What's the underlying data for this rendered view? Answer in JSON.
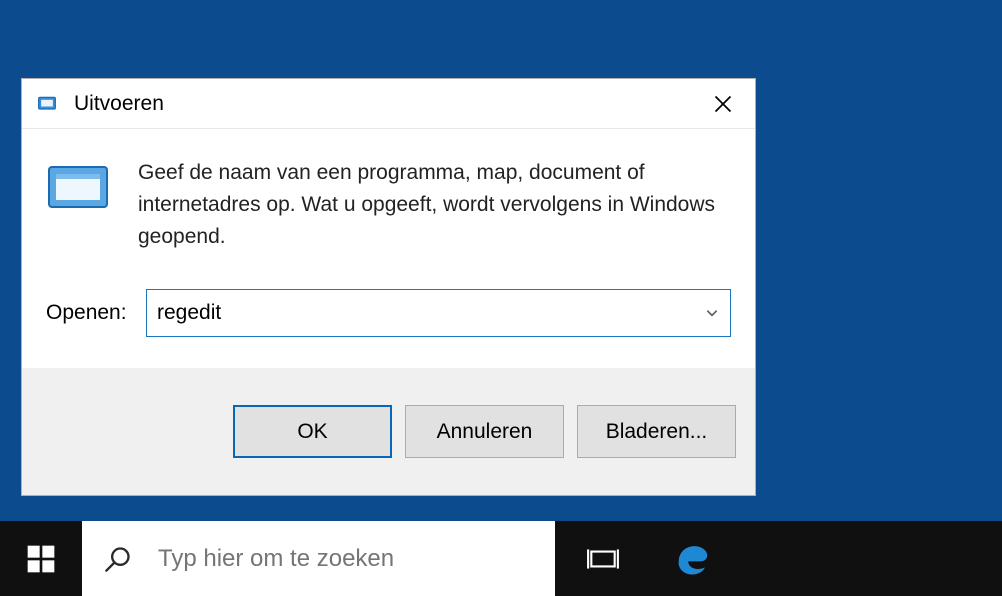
{
  "dialog": {
    "title": "Uitvoeren",
    "description": "Geef de naam van een programma, map, document of internetadres op. Wat u opgeeft, wordt vervolgens in Windows geopend.",
    "open_label": "Openen:",
    "open_value": "regedit",
    "buttons": {
      "ok": "OK",
      "cancel": "Annuleren",
      "browse": "Bladeren..."
    },
    "icons": {
      "run_small": "run-icon",
      "run_large": "run-icon",
      "close": "close-icon",
      "chevron": "chevron-down-icon"
    }
  },
  "taskbar": {
    "search_placeholder": "Typ hier om te zoeken",
    "icons": {
      "start": "windows-start-icon",
      "search": "search-icon",
      "task_view": "task-view-icon",
      "edge": "edge-browser-icon"
    }
  }
}
